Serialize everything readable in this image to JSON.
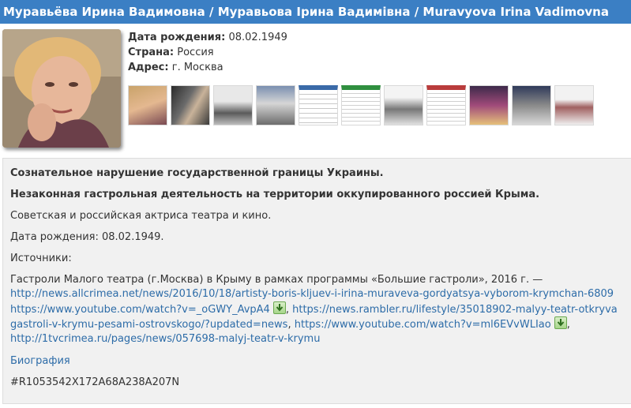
{
  "header": {
    "title": "Муравьёва Ирина Вадимовна / Муравьова Ірина Вадимівна / Muravyova Irina Vadimovna"
  },
  "profile": {
    "birth_label": "Дата рождения:",
    "birth_value": "08.02.1949",
    "country_label": "Страна:",
    "country_value": "Россия",
    "address_label": "Адрес:",
    "address_value": "г. Москва",
    "thumbnail_count": 11
  },
  "content": {
    "line1": "Сознательное нарушение государственной границы Украины.",
    "line2": "Незаконная гастрольная деятельность на территории оккупированного россией Крыма.",
    "line3": "Советская и российская актриса театра и кино.",
    "line4": "Дата рождения: 08.02.1949.",
    "sources_label": "Источники:",
    "tour_text": "Гастроли Малого театра (г.Москва) в Крыму в рамках программы «Большие гастроли», 2016 г. —",
    "link1": "http://news.allcrimea.net/news/2016/10/18/artisty-boris-kljuev-i-irina-muraveva-gordyatsya-vyborom-krymchan-6809",
    "link2": "https://www.youtube.com/watch?v=_oGWY_AvpA4",
    "link3": "https://news.rambler.ru/lifestyle/35018902-malyy-teatr-otkryva",
    "link3_cont": "gastroli-v-krymu-pesami-ostrovskogo/?updated=news",
    "link4": "https://www.youtube.com/watch?v=ml6EVvWLIao",
    "link5": "http://1tvcrimea.ru/pages/news/057698-malyj-teatr-v-krymu",
    "sep": ",",
    "biography_link": "Биография",
    "code": "#R1053542X172A68A238A207N"
  },
  "colors": {
    "header_bg": "#3b7fc4",
    "link": "#2d6ca8",
    "box_bg": "#f1f1f1"
  }
}
